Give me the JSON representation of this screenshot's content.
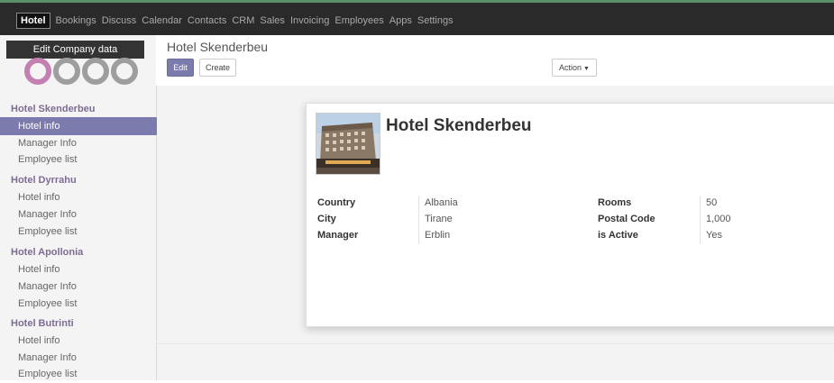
{
  "topnav": {
    "items": [
      "Hotel",
      "Bookings",
      "Discuss",
      "Calendar",
      "Contacts",
      "CRM",
      "Sales",
      "Invoicing",
      "Employees",
      "Apps",
      "Settings"
    ],
    "active": "Hotel"
  },
  "sidebar": {
    "edit_company": "Edit Company data",
    "groups": [
      {
        "title": "Hotel Skenderbeu",
        "items": [
          "Hotel info",
          "Manager Info",
          "Employee list"
        ]
      },
      {
        "title": "Hotel Dyrrahu",
        "items": [
          "Hotel info",
          "Manager Info",
          "Employee list"
        ]
      },
      {
        "title": "Hotel Apollonia",
        "items": [
          "Hotel info",
          "Manager Info",
          "Employee list"
        ]
      },
      {
        "title": "Hotel Butrinti",
        "items": [
          "Hotel info",
          "Manager Info",
          "Employee list"
        ]
      }
    ],
    "active_item": "Hotel Skenderbeu / Hotel info"
  },
  "control": {
    "breadcrumb": "Hotel Skenderbeu",
    "edit_label": "Edit",
    "create_label": "Create",
    "action_label": "Action"
  },
  "record": {
    "name": "Hotel Skenderbeu",
    "fields_left": [
      {
        "label": "Country",
        "value": "Albania"
      },
      {
        "label": "City",
        "value": "Tirane"
      },
      {
        "label": "Manager",
        "value": "Erblin"
      }
    ],
    "fields_right": [
      {
        "label": "Rooms",
        "value": "50"
      },
      {
        "label": "Postal Code",
        "value": "1,000"
      },
      {
        "label": "is Active",
        "value": "Yes"
      }
    ]
  },
  "colors": {
    "brand": "#7c7bad",
    "navbar": "#2a2a2a",
    "sidebar_heading": "#7c6d93",
    "logo_circle_1": "#c47fb3",
    "logo_circle_other": "#9e9e9e"
  }
}
